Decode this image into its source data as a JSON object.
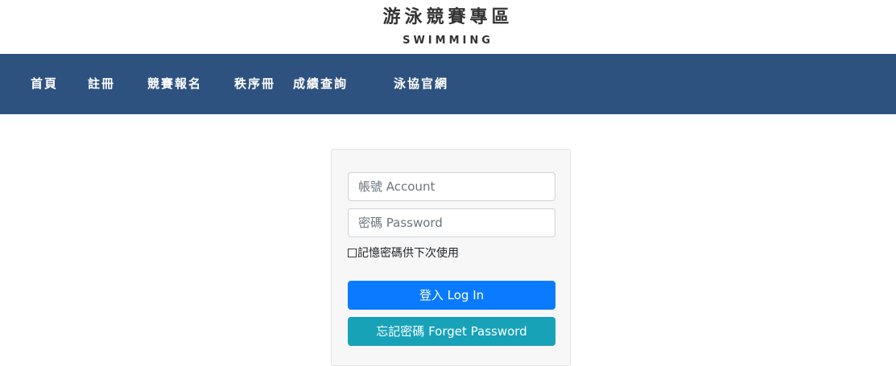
{
  "header": {
    "title": "游泳競賽專區",
    "subtitle": "SWIMMING"
  },
  "nav": {
    "items": [
      {
        "label": "首頁"
      },
      {
        "label": "註冊"
      },
      {
        "label": "競賽報名"
      },
      {
        "label": "秩序冊"
      },
      {
        "label": "成績查詢"
      },
      {
        "label": "泳協官網"
      }
    ]
  },
  "login": {
    "account_placeholder": "帳號 Account",
    "password_placeholder": "密碼 Password",
    "remember_label": "記憶密碼供下次使用",
    "login_button": "登入 Log In",
    "forget_button": "忘記密碼 Forget Password"
  },
  "colors": {
    "navbar": "#2e527f",
    "login_button": "#0a7bff",
    "forget_button": "#17a2b8"
  }
}
